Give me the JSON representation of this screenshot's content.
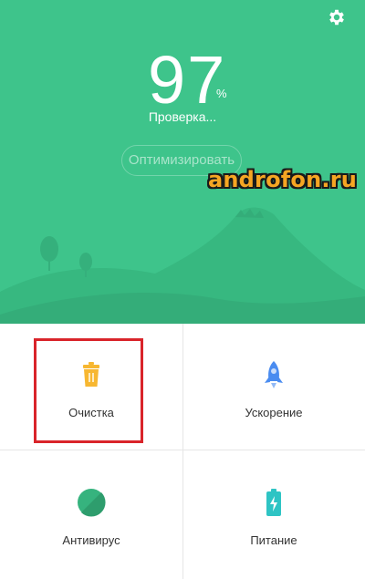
{
  "header": {
    "score": "97",
    "percent_sign": "%",
    "status": "Проверка...",
    "optimize_button": "Оптимизировать",
    "settings_icon": "gear-icon",
    "background_color": "#3ec48b"
  },
  "watermark": "androfon.ru",
  "tiles": [
    {
      "label": "Очистка",
      "icon": "trash-icon",
      "color": "#f7b731"
    },
    {
      "label": "Ускорение",
      "icon": "rocket-icon",
      "color": "#4a8cf0"
    },
    {
      "label": "Антивирус",
      "icon": "shield-icon",
      "color": "#36b37e"
    },
    {
      "label": "Питание",
      "icon": "battery-icon",
      "color": "#2ec4c4"
    }
  ]
}
